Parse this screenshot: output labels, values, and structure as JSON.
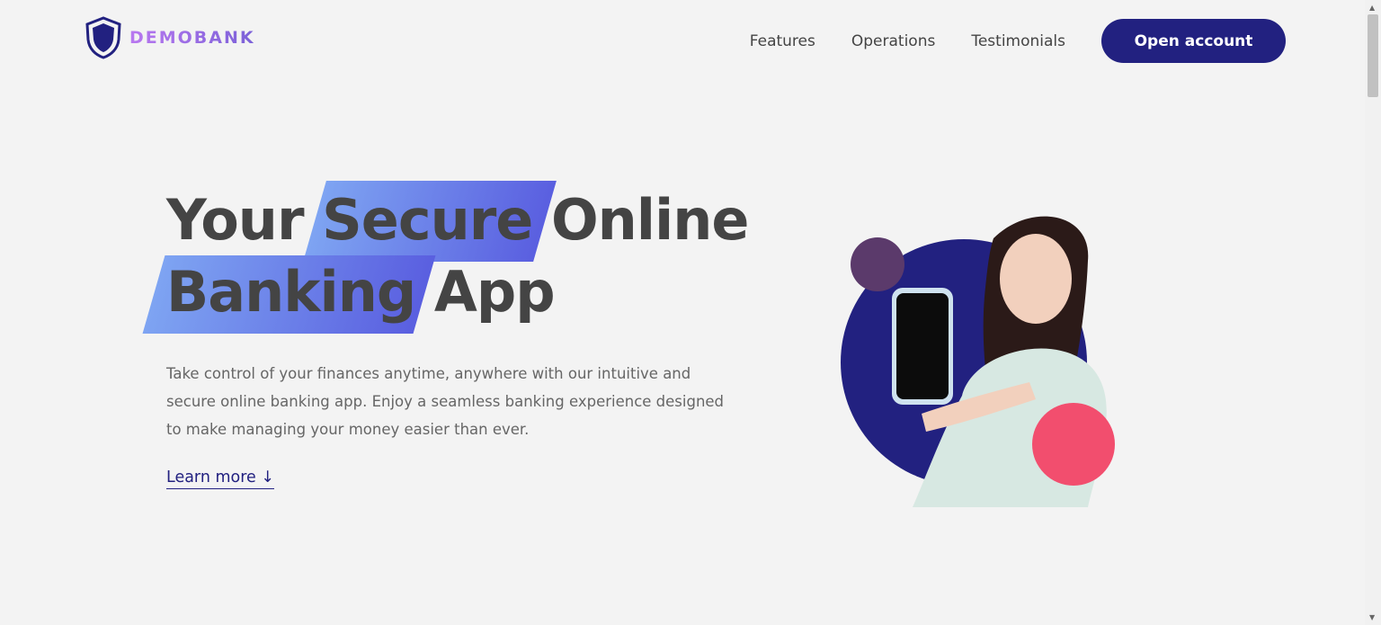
{
  "brand": {
    "name": "DEMOBANK"
  },
  "nav": {
    "links": [
      "Features",
      "Operations",
      "Testimonials"
    ],
    "cta": "Open account"
  },
  "hero": {
    "title_part1": "Your",
    "title_highlight1": "Secure",
    "title_part2": "Online",
    "title_highlight2": "Banking",
    "title_part3": "App",
    "description": "Take control of your finances anytime, anywhere with our intuitive and secure online banking app. Enjoy a seamless banking experience designed to make managing your money easier than ever.",
    "learn_more": "Learn more ↓"
  },
  "colors": {
    "primary": "#222180",
    "highlight_start": "#7ea4f2",
    "highlight_end": "#5a5fe0",
    "accent_pink": "#f24e6e",
    "accent_purple": "#5b3a6b",
    "background": "#f3f3f3"
  },
  "icons": {
    "logo": "shield-icon"
  }
}
